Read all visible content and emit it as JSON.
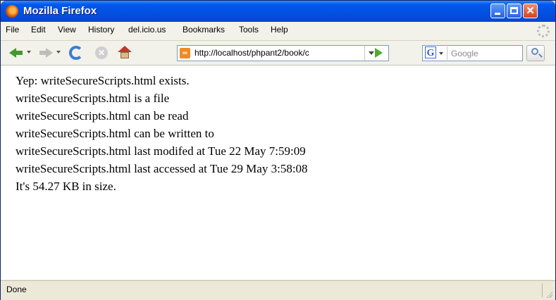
{
  "window": {
    "title": "Mozilla Firefox"
  },
  "menubar": {
    "items": [
      "File",
      "Edit",
      "View",
      "History",
      "del.icio.us",
      "Bookmarks",
      "Tools",
      "Help"
    ]
  },
  "navbar": {
    "url": "http://localhost/phpant2/book/c",
    "search_placeholder": "Google",
    "search_engine_glyph": "G"
  },
  "content": {
    "lines": [
      "Yep: writeSecureScripts.html exists.",
      "writeSecureScripts.html is a file",
      "writeSecureScripts.html can be read",
      "writeSecureScripts.html can be written to",
      "writeSecureScripts.html last modifed at Tue 22 May 7:59:09",
      "writeSecureScripts.html last accessed at Tue 29 May 3:58:08",
      "It's 54.27 KB in size."
    ]
  },
  "statusbar": {
    "text": "Done"
  },
  "colors": {
    "titlebar": "#0058ee",
    "chrome": "#ece9d8",
    "close_button": "#d7431c",
    "go_arrow": "#4caa31"
  }
}
